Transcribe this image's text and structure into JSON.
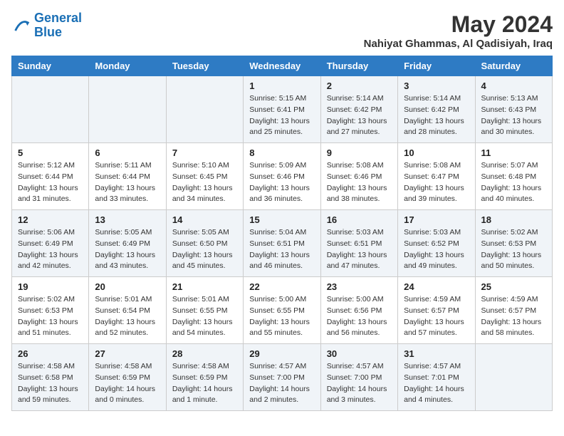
{
  "logo": {
    "line1": "General",
    "line2": "Blue"
  },
  "title": "May 2024",
  "location": "Nahiyat Ghammas, Al Qadisiyah, Iraq",
  "days_of_week": [
    "Sunday",
    "Monday",
    "Tuesday",
    "Wednesday",
    "Thursday",
    "Friday",
    "Saturday"
  ],
  "weeks": [
    [
      {
        "day": "",
        "info": ""
      },
      {
        "day": "",
        "info": ""
      },
      {
        "day": "",
        "info": ""
      },
      {
        "day": "1",
        "info": "Sunrise: 5:15 AM\nSunset: 6:41 PM\nDaylight: 13 hours\nand 25 minutes."
      },
      {
        "day": "2",
        "info": "Sunrise: 5:14 AM\nSunset: 6:42 PM\nDaylight: 13 hours\nand 27 minutes."
      },
      {
        "day": "3",
        "info": "Sunrise: 5:14 AM\nSunset: 6:42 PM\nDaylight: 13 hours\nand 28 minutes."
      },
      {
        "day": "4",
        "info": "Sunrise: 5:13 AM\nSunset: 6:43 PM\nDaylight: 13 hours\nand 30 minutes."
      }
    ],
    [
      {
        "day": "5",
        "info": "Sunrise: 5:12 AM\nSunset: 6:44 PM\nDaylight: 13 hours\nand 31 minutes."
      },
      {
        "day": "6",
        "info": "Sunrise: 5:11 AM\nSunset: 6:44 PM\nDaylight: 13 hours\nand 33 minutes."
      },
      {
        "day": "7",
        "info": "Sunrise: 5:10 AM\nSunset: 6:45 PM\nDaylight: 13 hours\nand 34 minutes."
      },
      {
        "day": "8",
        "info": "Sunrise: 5:09 AM\nSunset: 6:46 PM\nDaylight: 13 hours\nand 36 minutes."
      },
      {
        "day": "9",
        "info": "Sunrise: 5:08 AM\nSunset: 6:46 PM\nDaylight: 13 hours\nand 38 minutes."
      },
      {
        "day": "10",
        "info": "Sunrise: 5:08 AM\nSunset: 6:47 PM\nDaylight: 13 hours\nand 39 minutes."
      },
      {
        "day": "11",
        "info": "Sunrise: 5:07 AM\nSunset: 6:48 PM\nDaylight: 13 hours\nand 40 minutes."
      }
    ],
    [
      {
        "day": "12",
        "info": "Sunrise: 5:06 AM\nSunset: 6:49 PM\nDaylight: 13 hours\nand 42 minutes."
      },
      {
        "day": "13",
        "info": "Sunrise: 5:05 AM\nSunset: 6:49 PM\nDaylight: 13 hours\nand 43 minutes."
      },
      {
        "day": "14",
        "info": "Sunrise: 5:05 AM\nSunset: 6:50 PM\nDaylight: 13 hours\nand 45 minutes."
      },
      {
        "day": "15",
        "info": "Sunrise: 5:04 AM\nSunset: 6:51 PM\nDaylight: 13 hours\nand 46 minutes."
      },
      {
        "day": "16",
        "info": "Sunrise: 5:03 AM\nSunset: 6:51 PM\nDaylight: 13 hours\nand 47 minutes."
      },
      {
        "day": "17",
        "info": "Sunrise: 5:03 AM\nSunset: 6:52 PM\nDaylight: 13 hours\nand 49 minutes."
      },
      {
        "day": "18",
        "info": "Sunrise: 5:02 AM\nSunset: 6:53 PM\nDaylight: 13 hours\nand 50 minutes."
      }
    ],
    [
      {
        "day": "19",
        "info": "Sunrise: 5:02 AM\nSunset: 6:53 PM\nDaylight: 13 hours\nand 51 minutes."
      },
      {
        "day": "20",
        "info": "Sunrise: 5:01 AM\nSunset: 6:54 PM\nDaylight: 13 hours\nand 52 minutes."
      },
      {
        "day": "21",
        "info": "Sunrise: 5:01 AM\nSunset: 6:55 PM\nDaylight: 13 hours\nand 54 minutes."
      },
      {
        "day": "22",
        "info": "Sunrise: 5:00 AM\nSunset: 6:55 PM\nDaylight: 13 hours\nand 55 minutes."
      },
      {
        "day": "23",
        "info": "Sunrise: 5:00 AM\nSunset: 6:56 PM\nDaylight: 13 hours\nand 56 minutes."
      },
      {
        "day": "24",
        "info": "Sunrise: 4:59 AM\nSunset: 6:57 PM\nDaylight: 13 hours\nand 57 minutes."
      },
      {
        "day": "25",
        "info": "Sunrise: 4:59 AM\nSunset: 6:57 PM\nDaylight: 13 hours\nand 58 minutes."
      }
    ],
    [
      {
        "day": "26",
        "info": "Sunrise: 4:58 AM\nSunset: 6:58 PM\nDaylight: 13 hours\nand 59 minutes."
      },
      {
        "day": "27",
        "info": "Sunrise: 4:58 AM\nSunset: 6:59 PM\nDaylight: 14 hours\nand 0 minutes."
      },
      {
        "day": "28",
        "info": "Sunrise: 4:58 AM\nSunset: 6:59 PM\nDaylight: 14 hours\nand 1 minute."
      },
      {
        "day": "29",
        "info": "Sunrise: 4:57 AM\nSunset: 7:00 PM\nDaylight: 14 hours\nand 2 minutes."
      },
      {
        "day": "30",
        "info": "Sunrise: 4:57 AM\nSunset: 7:00 PM\nDaylight: 14 hours\nand 3 minutes."
      },
      {
        "day": "31",
        "info": "Sunrise: 4:57 AM\nSunset: 7:01 PM\nDaylight: 14 hours\nand 4 minutes."
      },
      {
        "day": "",
        "info": ""
      }
    ]
  ]
}
